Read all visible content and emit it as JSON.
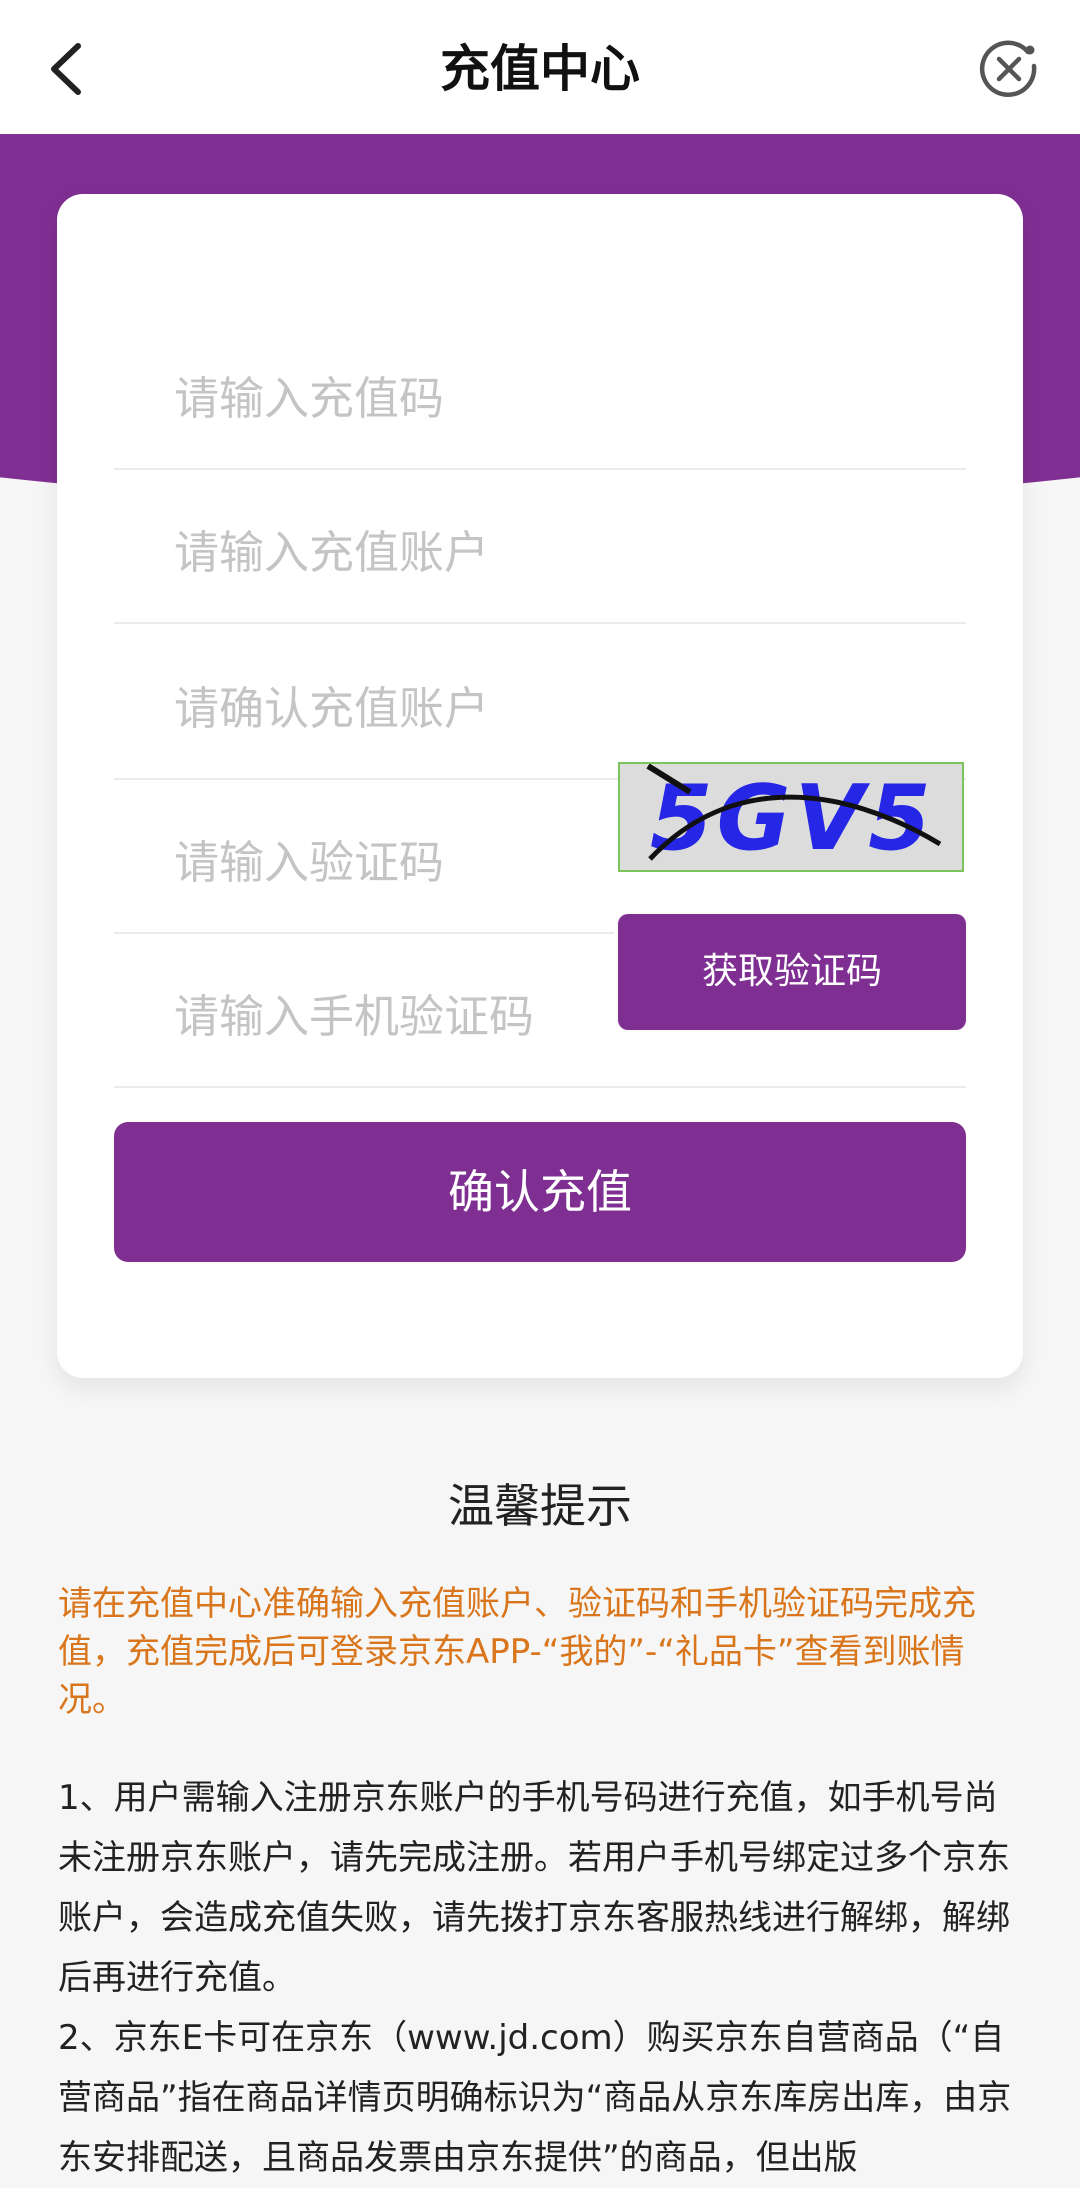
{
  "header": {
    "title": "充值中心"
  },
  "form": {
    "recharge_code_placeholder": "请输入充值码",
    "account_placeholder": "请输入充值账户",
    "confirm_account_placeholder": "请确认充值账户",
    "captcha_placeholder": "请输入验证码",
    "captcha_text": "5GV5",
    "sms_code_placeholder": "请输入手机验证码",
    "get_code_label": "获取验证码",
    "submit_label": "确认充值"
  },
  "tips": {
    "title": "温馨提示",
    "highlight": "请在充值中心准确输入充值账户、验证码和手机验证码完成充值，充值完成后可登录京东APP-“我的”-“礼品卡”查看到账情况。",
    "items": [
      "1、用户需输入注册京东账户的手机号码进行充值，如手机号尚未注册京东账户，请先完成注册。若用户手机号绑定过多个京东账户，会造成充值失败，请先拨打京东客服热线进行解绑，解绑后再进行充值。",
      "2、京东E卡可在京东（www.jd.com）购买京东自营商品（“自营商品”指在商品详情页明确标识为“商品从京东库房出库，由京东安排配送，且商品发票由京东提供”的商品，但出版"
    ]
  },
  "colors": {
    "brand_purple": "#7f2f92",
    "tip_orange": "#d9751a"
  }
}
